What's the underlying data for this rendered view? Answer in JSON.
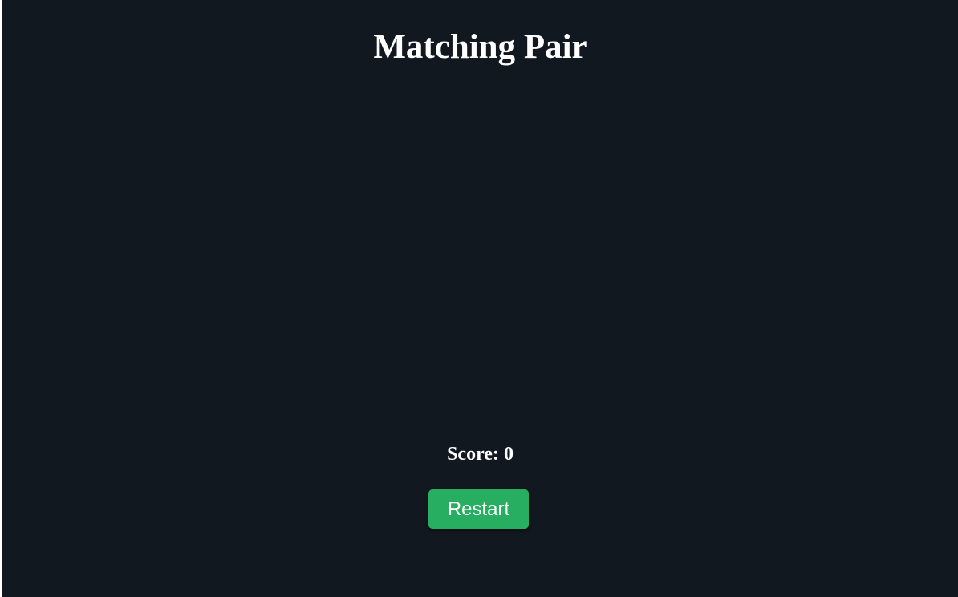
{
  "game": {
    "title": "Matching Pair",
    "score_label": "Score:",
    "score_value": "0",
    "restart_label": "Restart"
  },
  "colors": {
    "background": "#111820",
    "text": "#ffffff",
    "restart_button": "#27ae60"
  }
}
